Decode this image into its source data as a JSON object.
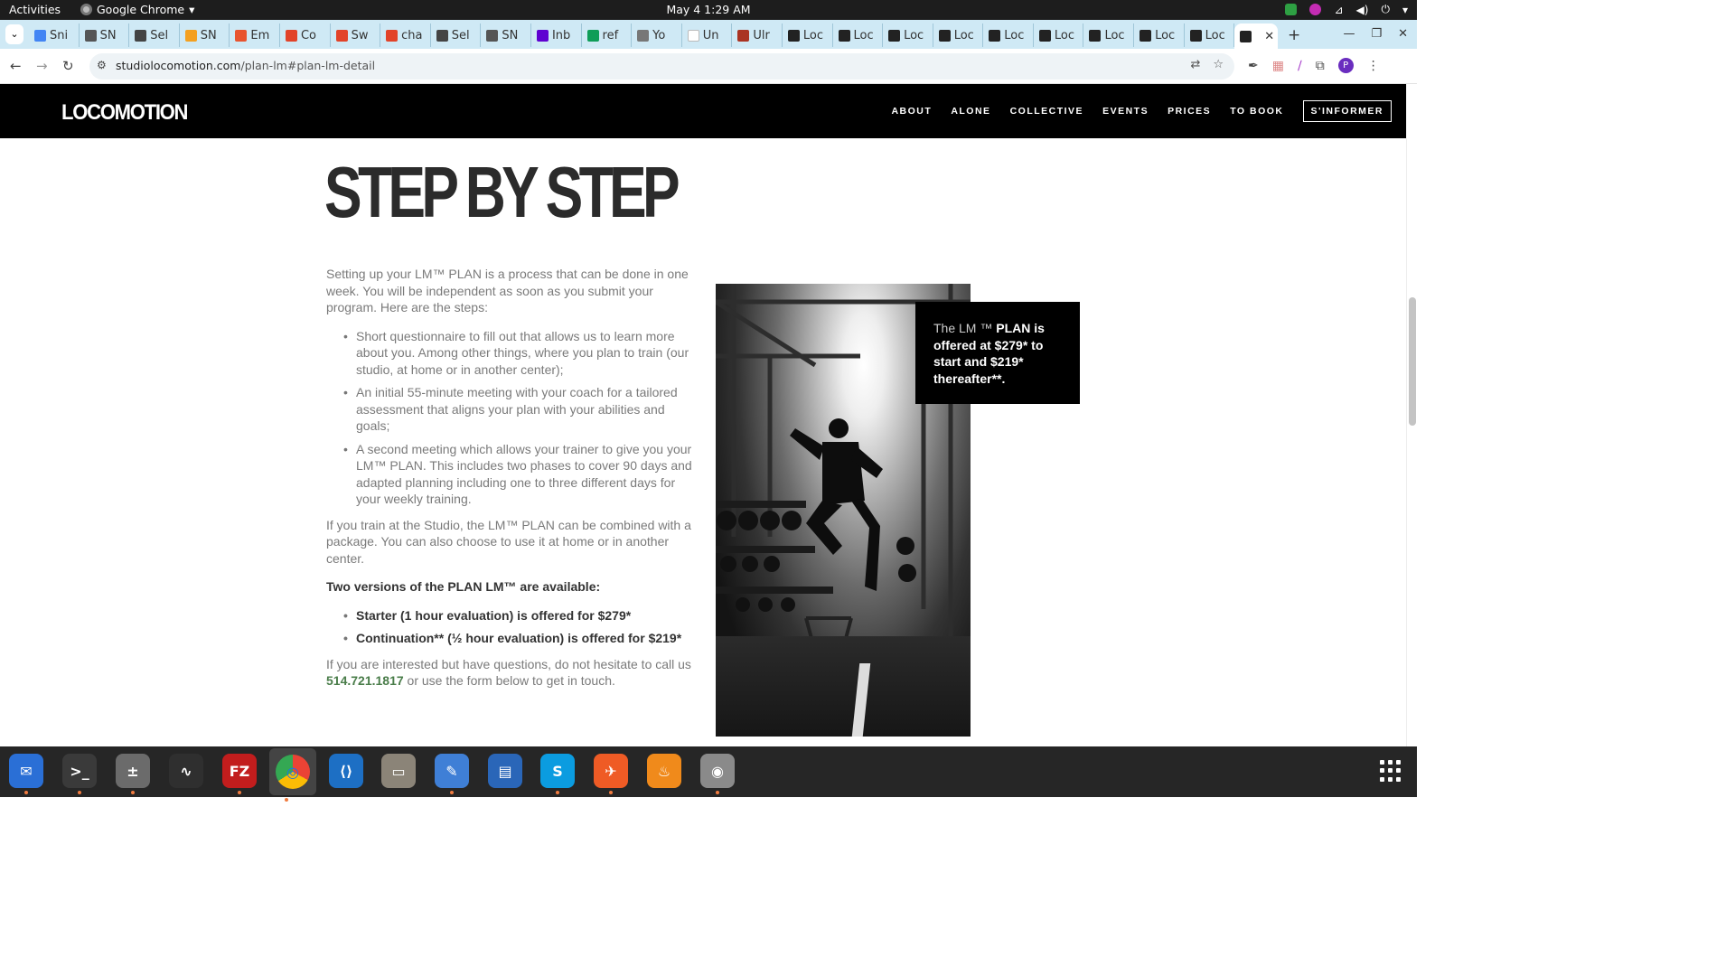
{
  "system": {
    "activities": "Activities",
    "app_name": "Google Chrome",
    "clock": "May 4  1:29 AM"
  },
  "browser": {
    "tabs": [
      {
        "label": "Sni",
        "icon": "docs-icon",
        "color": "#4285f4"
      },
      {
        "label": "SN",
        "icon": "snp-icon",
        "color": "#555555"
      },
      {
        "label": "Sel",
        "icon": "selenium-icon",
        "color": "#444444"
      },
      {
        "label": "SN",
        "icon": "emoji-icon",
        "color": "#f4a020"
      },
      {
        "label": "Em",
        "icon": "emoji-icon",
        "color": "#e8542f"
      },
      {
        "label": "Co",
        "icon": "gitlab-icon",
        "color": "#e24329"
      },
      {
        "label": "Sw",
        "icon": "gitlab-icon",
        "color": "#e24329"
      },
      {
        "label": "cha",
        "icon": "gitlab-icon",
        "color": "#e24329"
      },
      {
        "label": "Sel",
        "icon": "selenium-icon",
        "color": "#444444"
      },
      {
        "label": "SN",
        "icon": "snp-icon",
        "color": "#555555"
      },
      {
        "label": "Inb",
        "icon": "yahoo-icon",
        "color": "#5f01d1"
      },
      {
        "label": "ref",
        "icon": "sheets-icon",
        "color": "#0f9d58"
      },
      {
        "label": "Yo",
        "icon": "globe-icon",
        "color": "#777777"
      },
      {
        "label": "Un",
        "icon": "blank-page-icon",
        "color": "#ffffff"
      },
      {
        "label": "Ulr",
        "icon": "ulr-icon",
        "color": "#aa3322"
      },
      {
        "label": "Loc",
        "icon": "locomotion-icon",
        "color": "#222222"
      },
      {
        "label": "Loc",
        "icon": "locomotion-icon",
        "color": "#222222"
      },
      {
        "label": "Loc",
        "icon": "locomotion-icon",
        "color": "#222222"
      },
      {
        "label": "Loc",
        "icon": "locomotion-icon",
        "color": "#222222"
      },
      {
        "label": "Loc",
        "icon": "locomotion-icon",
        "color": "#222222"
      },
      {
        "label": "Loc",
        "icon": "locomotion-icon",
        "color": "#222222"
      },
      {
        "label": "Loc",
        "icon": "locomotion-icon",
        "color": "#222222"
      },
      {
        "label": "Loc",
        "icon": "locomotion-icon",
        "color": "#222222"
      },
      {
        "label": "Loc",
        "icon": "locomotion-icon",
        "color": "#222222"
      }
    ],
    "url_domain": "studiolocomotion.com",
    "url_path": "/plan-lm#plan-lm-detail",
    "profile_initial": "P"
  },
  "site": {
    "logo": "LOCOMOTION",
    "nav": [
      "ABOUT",
      "ALONE",
      "COLLECTIVE",
      "EVENTS",
      "PRICES",
      "TO BOOK"
    ],
    "nav_cta": "S'INFORMER",
    "heading": "STEP BY STEP",
    "intro": "Setting up your LM™ PLAN is a process that can be done in one week. You will be independent as soon as you submit your program. Here are the steps:",
    "steps": [
      "Short questionnaire to fill out that allows us to learn more about you. Among other things, where you plan to train (our studio, at home or in another center);",
      "An initial 55-minute meeting with your coach for a tailored assessment that aligns your plan with your abilities and goals;",
      "A second meeting which allows your trainer to give you your LM™ PLAN. This includes two phases to cover 90 days and adapted planning including one to three different days for your weekly training."
    ],
    "studio_note": "If you train at the Studio, the LM™ PLAN can be combined with a package. You can also choose to use it at home or in another center.",
    "versions_title": "Two versions of the PLAN LM™ are available:",
    "versions": [
      "Starter (1 hour evaluation) is offered for $279*",
      "Continuation** (½ hour evaluation) is offered for $219*"
    ],
    "contact_before": "If you are interested but have questions, do not hesitate to call us",
    "phone": "514.721.1817",
    "contact_after": "or use the form below to get in touch.",
    "pricebox_lead": "The LM ™",
    "pricebox_bold": "PLAN is offered at $279* to start and $219* thereafter**."
  },
  "dock": [
    {
      "name": "thunderbird",
      "color": "#2a6fd6",
      "glyph": "✉"
    },
    {
      "name": "terminal",
      "color": "#3a3a3a",
      "glyph": ">_"
    },
    {
      "name": "calculator",
      "color": "#6b6b6b",
      "glyph": "±"
    },
    {
      "name": "system-monitor",
      "color": "#2f2f2f",
      "glyph": "∿"
    },
    {
      "name": "filezilla",
      "color": "#c21d1d",
      "glyph": "FZ"
    },
    {
      "name": "chrome",
      "color": "#dddddd",
      "glyph": "◎"
    },
    {
      "name": "vscode",
      "color": "#1d6fc4",
      "glyph": "⟨⟩"
    },
    {
      "name": "files",
      "color": "#8b8478",
      "glyph": "▭"
    },
    {
      "name": "text-editor",
      "color": "#3f7fd6",
      "glyph": "✎"
    },
    {
      "name": "libreoffice-writer",
      "color": "#2a66b8",
      "glyph": "▤"
    },
    {
      "name": "skype",
      "color": "#0b9ce0",
      "glyph": "S"
    },
    {
      "name": "postman",
      "color": "#ef5b25",
      "glyph": "✈"
    },
    {
      "name": "flame",
      "color": "#f08a1b",
      "glyph": "♨"
    },
    {
      "name": "disk-utility",
      "color": "#8a8a8a",
      "glyph": "◉"
    }
  ]
}
